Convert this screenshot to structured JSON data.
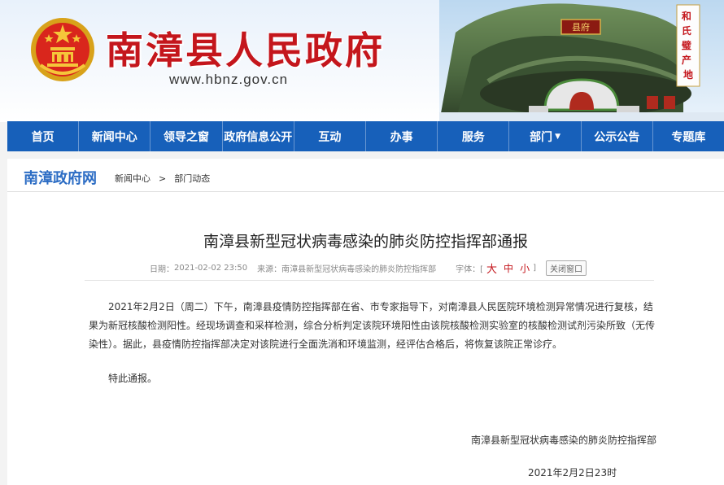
{
  "header": {
    "site_title": "南漳县人民政府",
    "site_url": "www.hbnz.gov.cn",
    "plaque_text": "县府",
    "seal_text": "和氏璧产地",
    "colors": {
      "title_red": "#c4161c",
      "nav_blue": "#1760ba",
      "logo_blue": "#2b6cc4"
    }
  },
  "nav": {
    "items": [
      {
        "label": "首页"
      },
      {
        "label": "新闻中心"
      },
      {
        "label": "领导之窗"
      },
      {
        "label": "政府信息公开"
      },
      {
        "label": "互动"
      },
      {
        "label": "办事"
      },
      {
        "label": "服务"
      },
      {
        "label": "部门",
        "dropdown": true
      },
      {
        "label": "公示公告"
      },
      {
        "label": "专题库"
      }
    ]
  },
  "breadcrumb": {
    "logo": "南漳政府网",
    "items": [
      "新闻中心",
      "部门动态"
    ],
    "separator": ">"
  },
  "article": {
    "title": "南漳县新型冠状病毒感染的肺炎防控指挥部通报",
    "meta": {
      "date_label": "日期：",
      "date": "2021-02-02 23:50",
      "source_label": "来源：",
      "source": "南漳县新型冠状病毒感染的肺炎防控指挥部",
      "font_label": "字体：[",
      "font_large": "大",
      "font_medium": "中",
      "font_small": "小",
      "font_end": "]",
      "close_button": "关闭窗口"
    },
    "paragraphs": [
      "2021年2月2日（周二）下午，南漳县疫情防控指挥部在省、市专家指导下，对南漳县人民医院环境检测异常情况进行复核，结果为新冠核酸检测阳性。经现场调查和采样检测，综合分析判定该院环境阳性由该院核酸检测实验室的核酸检测试剂污染所致（无传染性）。据此，县疫情防控指挥部决定对该院进行全面洗消和环境监测，经评估合格后，将恢复该院正常诊疗。",
      "特此通报。"
    ],
    "signature_org": "南漳县新型冠状病毒感染的肺炎防控指挥部",
    "signature_date": "2021年2月2日23时"
  }
}
